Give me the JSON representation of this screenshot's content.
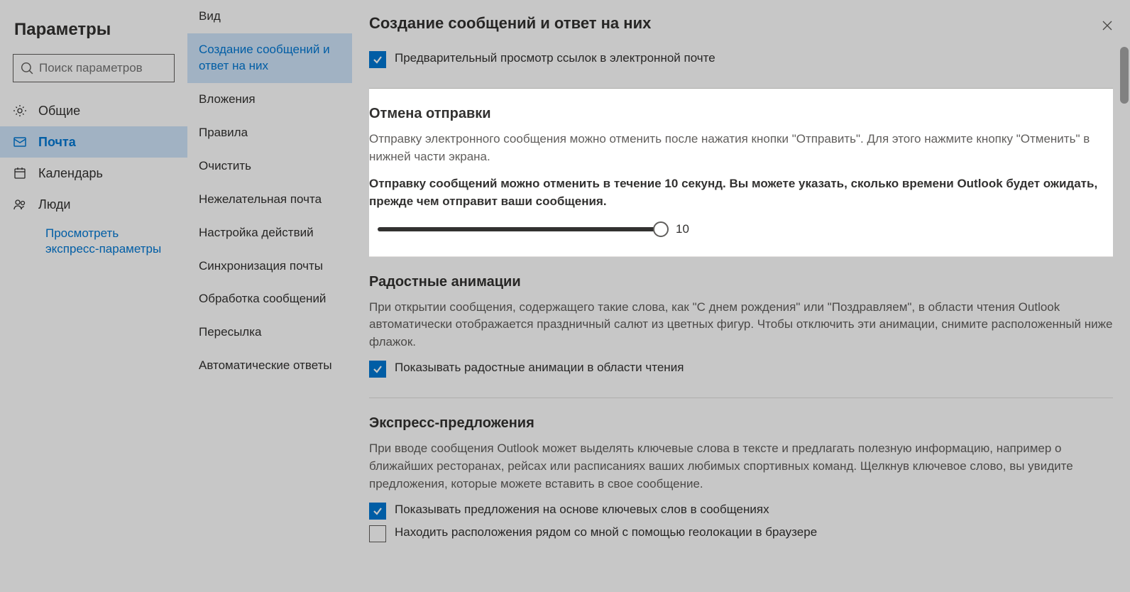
{
  "title": "Параметры",
  "search": {
    "placeholder": "Поиск параметров"
  },
  "nav": {
    "general": "Общие",
    "mail": "Почта",
    "calendar": "Календарь",
    "people": "Люди",
    "quick": "Просмотреть экспресс-параметры"
  },
  "subnav": {
    "items": [
      "Вид",
      "Создание сообщений и ответ на них",
      "Вложения",
      "Правила",
      "Очистить",
      "Нежелательная почта",
      "Настройка действий",
      "Синхронизация почты",
      "Обработка сообщений",
      "Пересылка",
      "Автоматические ответы"
    ]
  },
  "header": "Создание сообщений и ответ на них",
  "linkPreview": {
    "checkbox_label": "Предварительный просмотр ссылок в электронной почте"
  },
  "undoSend": {
    "title": "Отмена отправки",
    "desc": "Отправку электронного сообщения можно отменить после нажатия кнопки \"Отправить\". Для этого нажмите кнопку \"Отменить\" в нижней части экрана.",
    "bold": "Отправку сообщений можно отменить в течение 10 секунд. Вы можете указать, сколько времени Outlook будет ожидать, прежде чем отправит ваши сообщения.",
    "value": "10"
  },
  "joyful": {
    "title": "Радостные анимации",
    "desc": "При открытии сообщения, содержащего такие слова, как \"С днем рождения\" или \"Поздравляем\", в области чтения Outlook автоматически отображается праздничный салют из цветных фигур. Чтобы отключить эти анимации, снимите расположенный ниже флажок.",
    "checkbox_label": "Показывать радостные анимации в области чтения"
  },
  "suggestions": {
    "title": "Экспресс-предложения",
    "desc": "При вводе сообщения Outlook может выделять ключевые слова в тексте и предлагать полезную информацию, например о ближайших ресторанах, рейсах или расписаниях ваших любимых спортивных команд. Щелкнув ключевое слово, вы увидите предложения, которые можете вставить в свое сообщение.",
    "cb1": "Показывать предложения на основе ключевых слов в сообщениях",
    "cb2": "Находить расположения рядом со мной с помощью геолокации в браузере"
  }
}
